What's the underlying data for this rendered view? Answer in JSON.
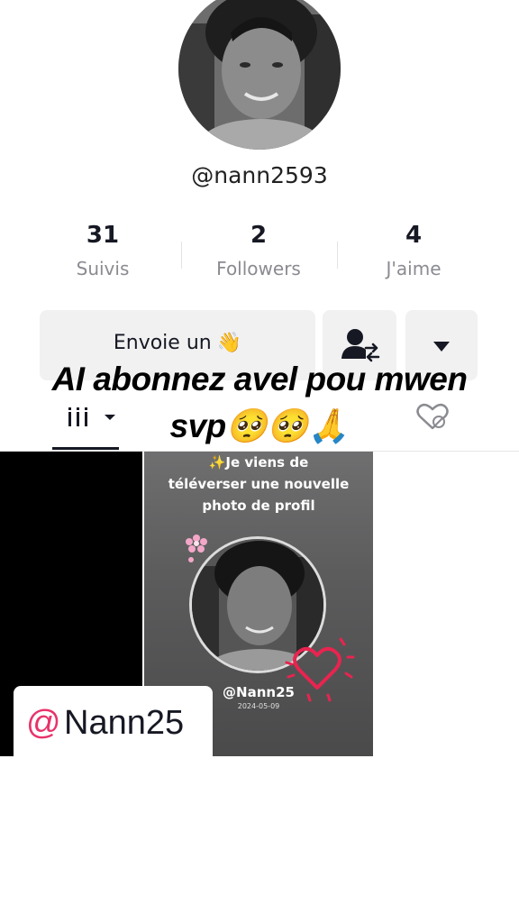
{
  "profile": {
    "username": "@nann2593",
    "stats": [
      {
        "value": "31",
        "label": "Suivis"
      },
      {
        "value": "2",
        "label": "Followers"
      },
      {
        "value": "4",
        "label": "J'aime"
      }
    ]
  },
  "actions": {
    "message_label": "Envoie un",
    "message_emoji": "👋"
  },
  "overlay_caption": {
    "line1": "AI abonnez avel pou mwen",
    "line2": "svp🥺🥺🙏"
  },
  "tabs": [
    {
      "icon": "grid-icon"
    },
    {
      "icon": "liked-hidden-icon"
    }
  ],
  "video_cell": {
    "caption_lines": [
      "✨Je viens de",
      "téléverser une nouvelle",
      "photo de profil"
    ],
    "handle": "@Nann25",
    "date": "2024-05-09"
  },
  "mention_tag": {
    "at": "@",
    "name": "Nann25"
  },
  "colors": {
    "accent": "#e8336b",
    "heart": "#e8244f",
    "text": "#161823",
    "muted": "#8a8b91"
  }
}
